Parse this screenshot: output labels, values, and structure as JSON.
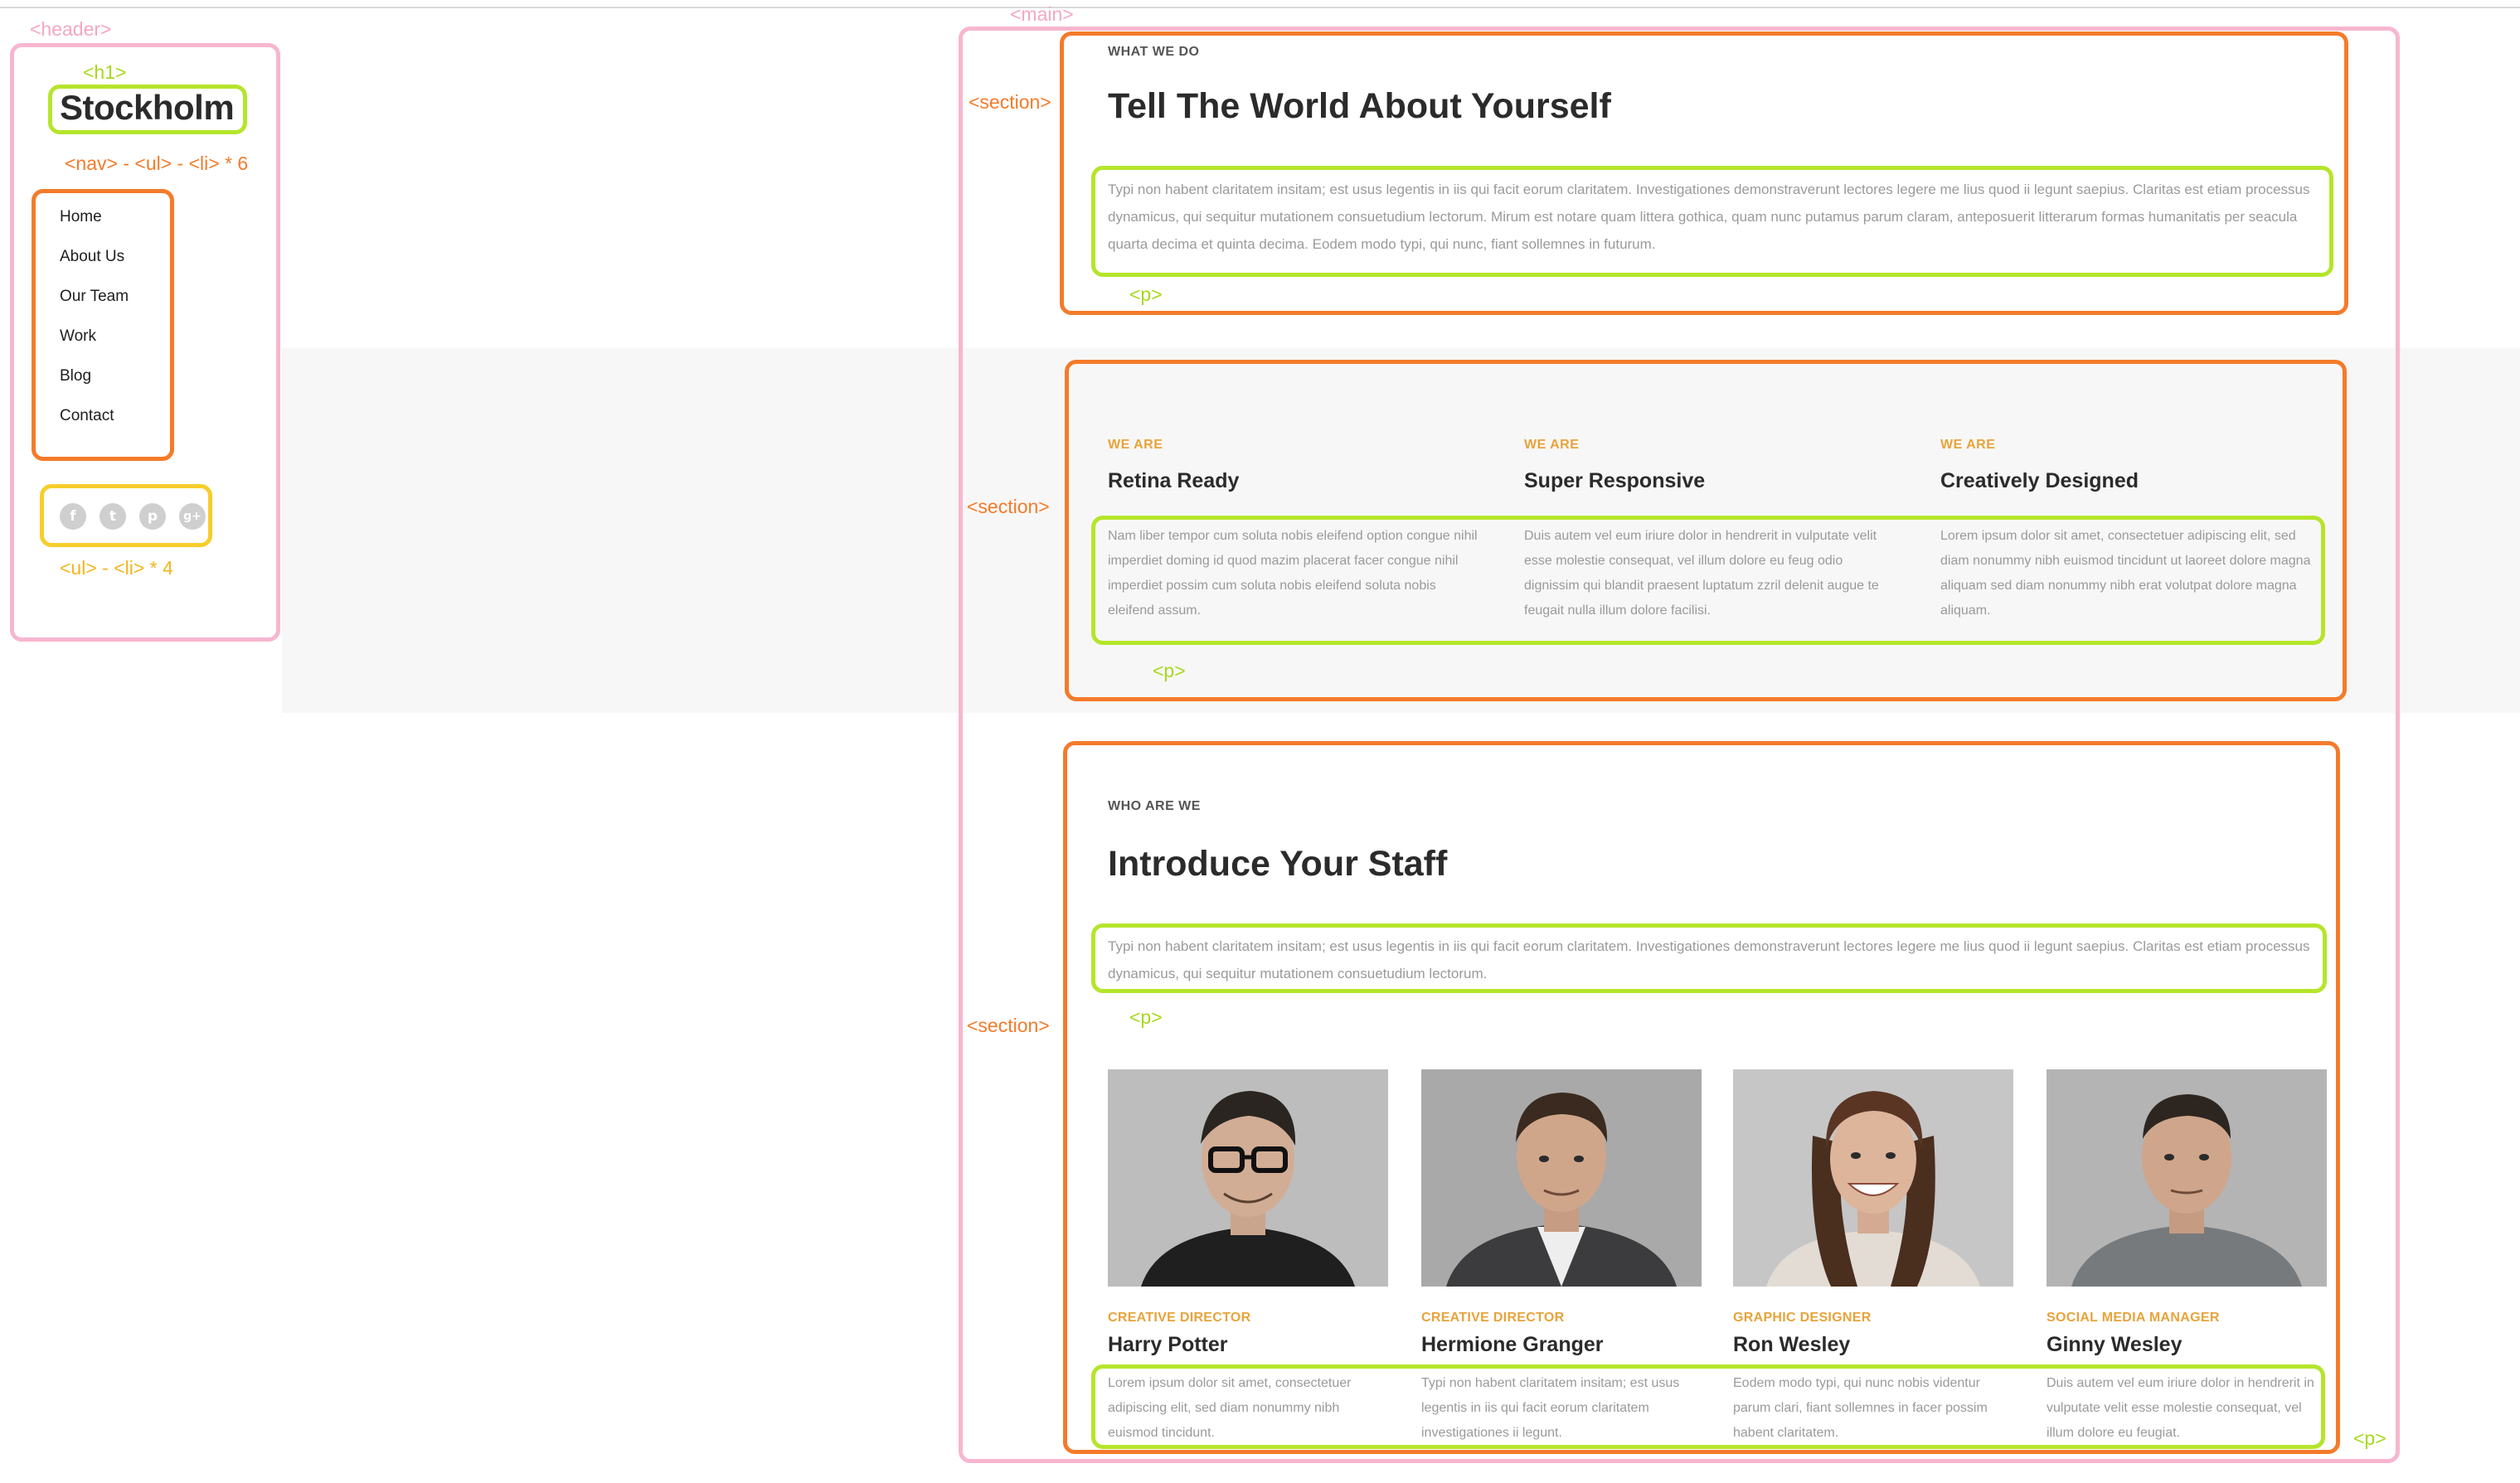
{
  "annotations": {
    "header": "<header>",
    "h1": "<h1>",
    "nav": "<nav> - <ul> - <li> * 6",
    "social": "<ul> - <li> * 4",
    "main": "<main>",
    "section": "<section>",
    "p": "<p>"
  },
  "header": {
    "logo": "Stockholm",
    "nav": [
      "Home",
      "About Us",
      "Our Team",
      "Work",
      "Blog",
      "Contact"
    ],
    "social": [
      {
        "icon": "facebook-icon",
        "glyph": "f"
      },
      {
        "icon": "twitter-icon",
        "glyph": "t"
      },
      {
        "icon": "pinterest-icon",
        "glyph": "p"
      },
      {
        "icon": "google-plus-icon",
        "glyph": "g+"
      }
    ]
  },
  "section1": {
    "eyebrow": "WHAT WE DO",
    "title": "Tell The World About Yourself",
    "text": "Typi non habent claritatem insitam; est usus legentis in iis qui facit eorum claritatem. Investigationes demonstraverunt lectores legere me lius quod ii legunt saepius. Claritas est etiam processus dynamicus, qui sequitur mutationem consuetudium lectorum. Mirum est notare quam littera gothica, quam nunc putamus parum claram, anteposuerit litterarum formas humanitatis per seacula quarta decima et quinta decima. Eodem modo typi, qui nunc, fiant sollemnes in futurum."
  },
  "section2": {
    "features": [
      {
        "eyebrow": "WE ARE",
        "title": "Retina Ready",
        "text": "Nam liber tempor cum soluta nobis eleifend option congue nihil imperdiet doming id quod mazim placerat facer congue nihil imperdiet possim cum soluta nobis eleifend soluta nobis eleifend assum."
      },
      {
        "eyebrow": "WE ARE",
        "title": "Super Responsive",
        "text": "Duis autem vel eum iriure dolor in hendrerit in vulputate velit esse molestie consequat, vel illum dolore eu feug odio dignissim qui blandit praesent luptatum zzril delenit augue te feugait nulla illum dolore facilisi."
      },
      {
        "eyebrow": "WE ARE",
        "title": "Creatively Designed",
        "text": "Lorem ipsum dolor sit amet, consectetuer adipiscing elit, sed diam nonummy nibh euismod tincidunt ut laoreet dolore magna aliquam sed diam nonummy nibh erat volutpat dolore magna aliquam."
      }
    ]
  },
  "section3": {
    "eyebrow": "WHO ARE WE",
    "title": "Introduce Your Staff",
    "text": "Typi non habent claritatem insitam; est usus legentis in iis qui facit eorum claritatem. Investigationes demonstraverunt lectores legere me lius quod ii legunt saepius. Claritas est etiam processus dynamicus, qui sequitur mutationem consuetudium lectorum.",
    "staff": [
      {
        "role": "CREATIVE DIRECTOR",
        "name": "Harry Potter",
        "bio": "Lorem ipsum dolor sit amet, consectetuer adipiscing elit, sed diam nonummy nibh euismod tincidunt."
      },
      {
        "role": "CREATIVE DIRECTOR",
        "name": "Hermione Granger",
        "bio": "Typi non habent claritatem insitam; est usus legentis in iis qui facit eorum claritatem investigationes ii legunt."
      },
      {
        "role": "GRAPHIC DESIGNER",
        "name": "Ron Wesley",
        "bio": "Eodem modo typi, qui nunc nobis videntur parum clari, fiant sollemnes in facer possim habent claritatem."
      },
      {
        "role": "SOCIAL MEDIA MANAGER",
        "name": "Ginny Wesley",
        "bio": "Duis autem vel eum iriure dolor in hendrerit in vulputate velit esse molestie consequat, vel illum dolore eu feugiat."
      }
    ]
  }
}
